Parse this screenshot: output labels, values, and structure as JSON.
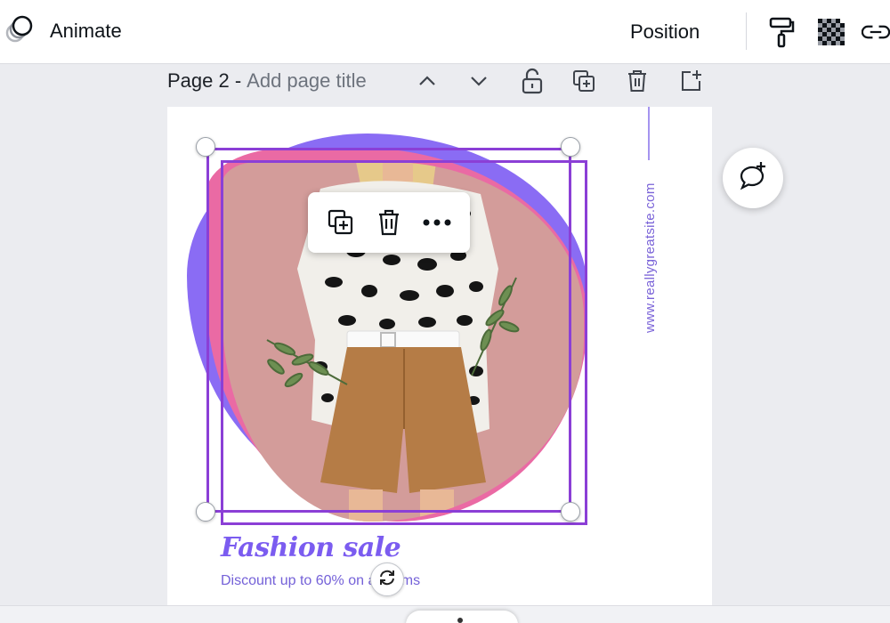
{
  "toolbar": {
    "animate_label": "Animate",
    "position_label": "Position",
    "icons": [
      "animate-icon",
      "paint-roller-icon",
      "transparency-icon",
      "link-icon"
    ]
  },
  "page_header": {
    "page_label": "Page 2 -",
    "title_placeholder": "Add page title",
    "icons": [
      "chevron-up-icon",
      "chevron-down-icon",
      "unlock-icon",
      "duplicate-page-icon",
      "delete-page-icon",
      "add-page-icon"
    ]
  },
  "design": {
    "vertical_url": "www.reallygreatsite.com",
    "headline": "Fashion sale",
    "subline": "Discount up to 60% on all items"
  },
  "context_toolbar": {
    "icons": [
      "duplicate-icon",
      "trash-icon",
      "more-icon"
    ]
  },
  "comment_button": {
    "icon": "add-comment-icon"
  },
  "colors": {
    "violet": "#8a6cf4",
    "pink": "#ea6aa4",
    "photo_bg": "#d39c9a",
    "selection": "#8b3fd6",
    "headline": "#7b5cf0"
  }
}
